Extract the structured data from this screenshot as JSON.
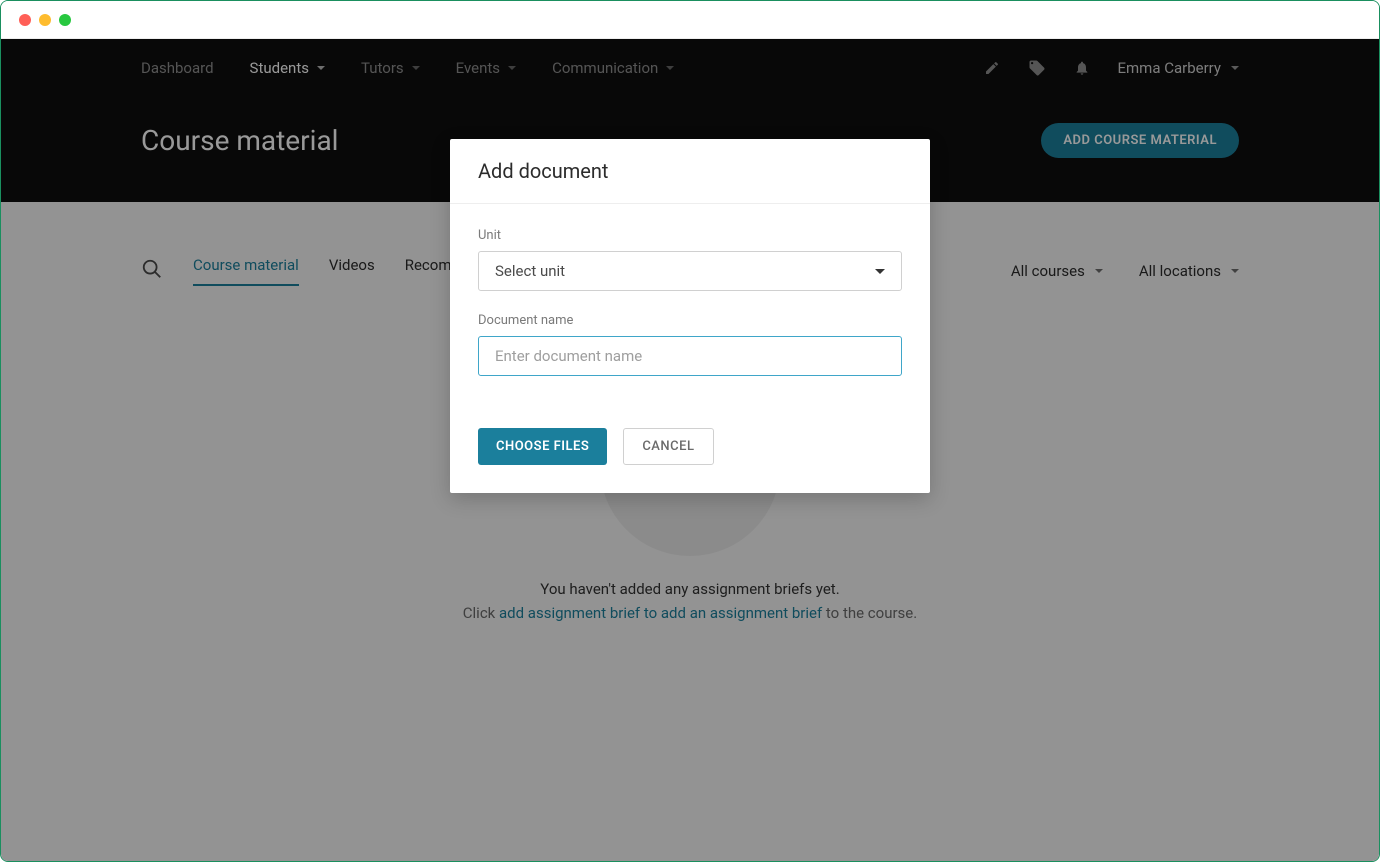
{
  "nav": {
    "items": [
      {
        "label": "Dashboard",
        "has_dropdown": false,
        "active": false
      },
      {
        "label": "Students",
        "has_dropdown": true,
        "active": true
      },
      {
        "label": "Tutors",
        "has_dropdown": true,
        "active": false
      },
      {
        "label": "Events",
        "has_dropdown": true,
        "active": false
      },
      {
        "label": "Communication",
        "has_dropdown": true,
        "active": false
      }
    ],
    "user_name": "Emma Carberry"
  },
  "page": {
    "title": "Course material",
    "add_button": "ADD COURSE MATERIAL"
  },
  "tabs": {
    "items": [
      {
        "label": "Course material",
        "active": true
      },
      {
        "label": "Videos",
        "active": false
      },
      {
        "label": "Recommended reading",
        "active": false
      }
    ],
    "filters": [
      {
        "label": "All courses"
      },
      {
        "label": "All locations"
      }
    ]
  },
  "empty": {
    "message": "You haven't added any assignment briefs  yet.",
    "sub_prefix": "Click ",
    "sub_link": "add assignment brief to add an assignment brief",
    "sub_suffix": " to the course."
  },
  "modal": {
    "title": "Add document",
    "unit_label": "Unit",
    "unit_placeholder": "Select unit",
    "doc_label": "Document name",
    "doc_placeholder": "Enter document name",
    "choose_files": "CHOOSE FILES",
    "cancel": "CANCEL"
  }
}
